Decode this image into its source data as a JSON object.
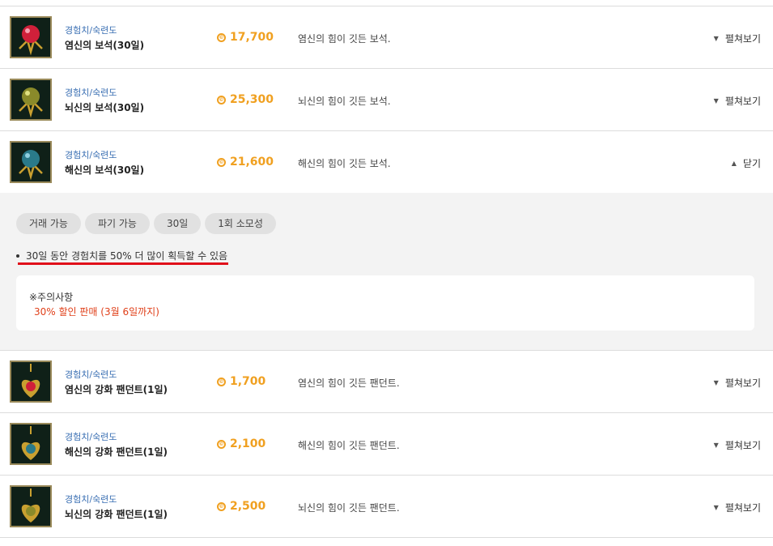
{
  "items": [
    {
      "category": "경험치/숙련도",
      "name": "염신의 보석(30일)",
      "price": "17,700",
      "description": "염신의 힘이 깃든 보석.",
      "toggle": "펼쳐보기",
      "expanded": false,
      "gem_color": "#d0203a"
    },
    {
      "category": "경험치/숙련도",
      "name": "뇌신의 보석(30일)",
      "price": "25,300",
      "description": "뇌신의 힘이 깃든 보석.",
      "toggle": "펼쳐보기",
      "expanded": false,
      "gem_color": "#8a8a2a"
    },
    {
      "category": "경험치/숙련도",
      "name": "해신의 보석(30일)",
      "price": "21,600",
      "description": "해신의 힘이 깃든 보석.",
      "toggle": "닫기",
      "expanded": true,
      "gem_color": "#2a7a8a"
    },
    {
      "category": "경험치/숙련도",
      "name": "염신의 강화 팬던트(1일)",
      "price": "1,700",
      "description": "염신의 힘이 깃든 팬던트.",
      "toggle": "펼쳐보기",
      "expanded": false,
      "gem_color": "#d0203a"
    },
    {
      "category": "경험치/숙련도",
      "name": "해신의 강화 팬던트(1일)",
      "price": "2,100",
      "description": "해신의 힘이 깃든 팬던트.",
      "toggle": "펼쳐보기",
      "expanded": false,
      "gem_color": "#2a7a8a"
    },
    {
      "category": "경험치/숙련도",
      "name": "뇌신의 강화 팬던트(1일)",
      "price": "2,500",
      "description": "뇌신의 힘이 깃든 팬던트.",
      "toggle": "펼쳐보기",
      "expanded": false,
      "gem_color": "#8a8a2a"
    }
  ],
  "detail": {
    "tags": [
      "거래 가능",
      "파기 가능",
      "30일",
      "1회 소모성"
    ],
    "effect": "30일 동안 경험치를 50% 더 많이 획득할 수 있음",
    "notice_title": "※주의사항",
    "notice_text": "30% 할인 판매 (3월 6일까지)"
  },
  "icons": {
    "coin": "coin-icon",
    "expand": "chevron-down-icon",
    "collapse": "chevron-up-icon"
  },
  "colors": {
    "price": "#f0a020",
    "category": "#3a6fb3",
    "underline": "#e0101a",
    "notice": "#e0401a"
  }
}
